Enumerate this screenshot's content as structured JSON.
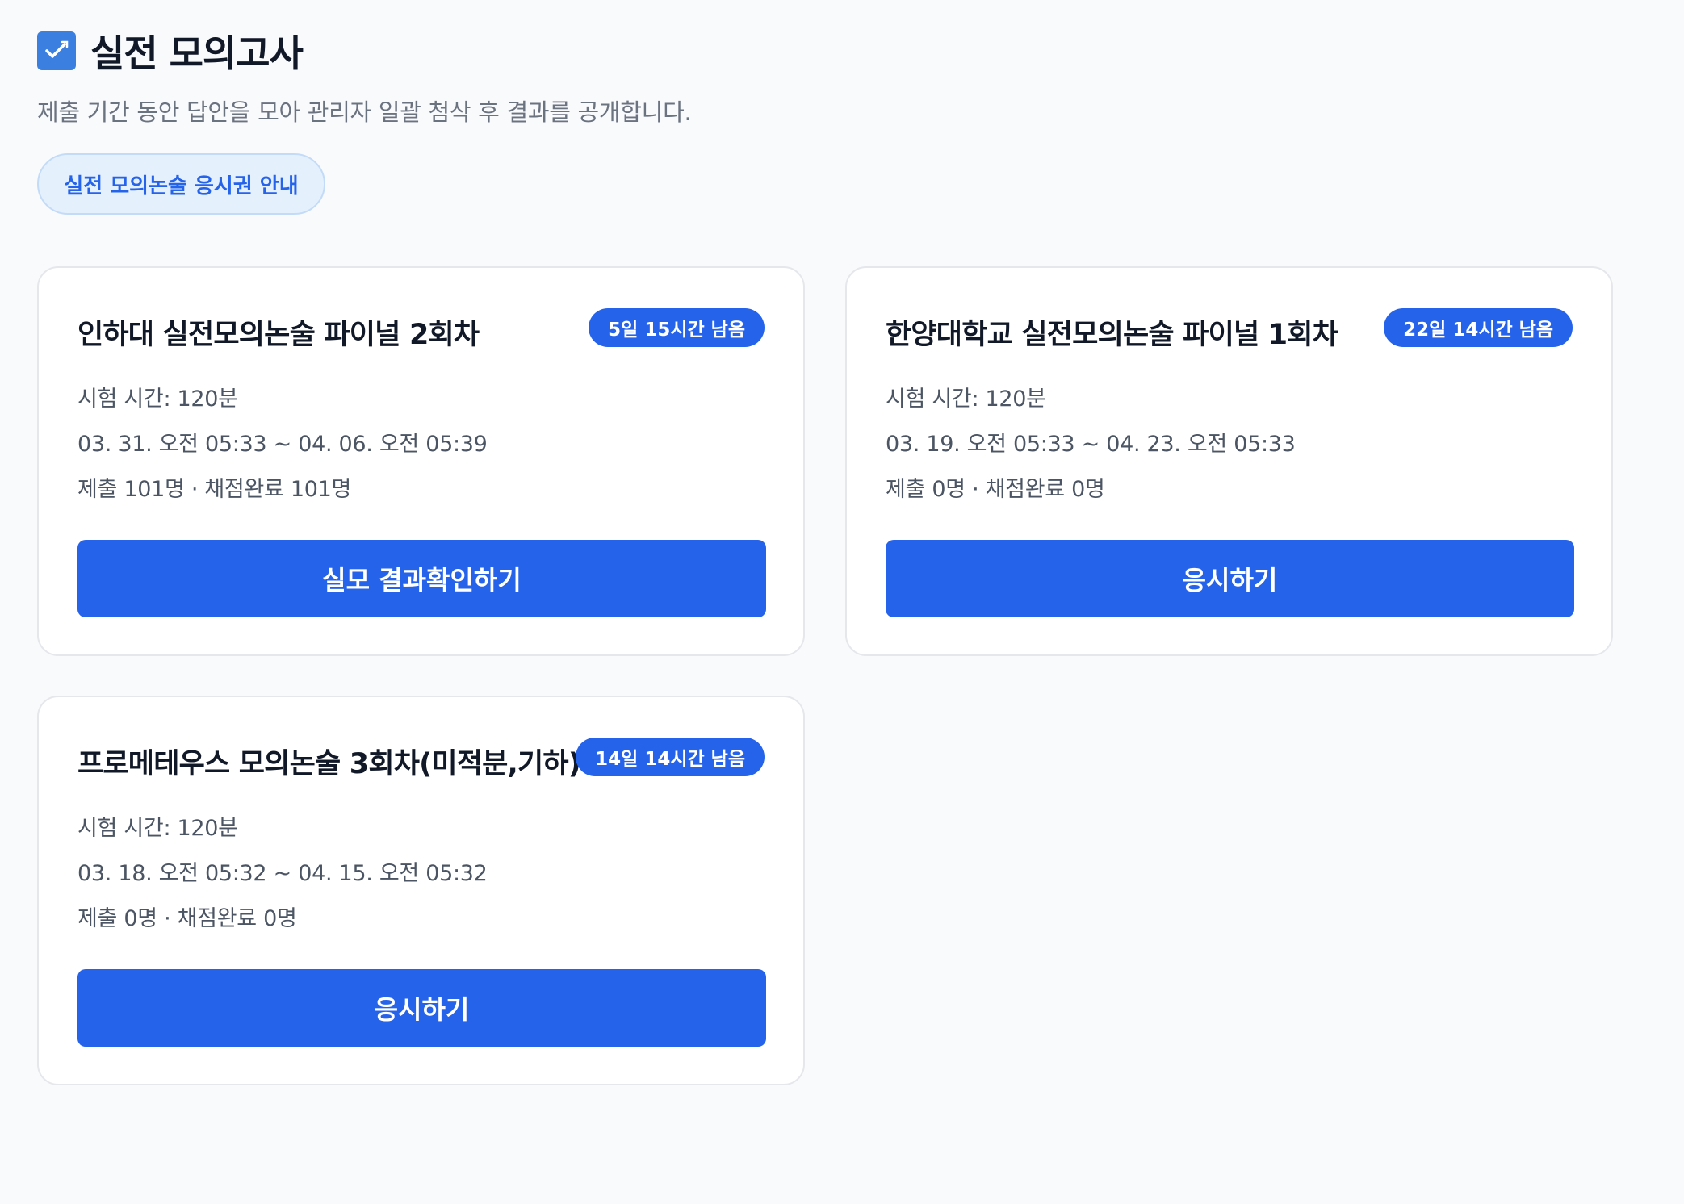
{
  "header": {
    "icon": "checkmark-pen-icon",
    "title": "실전 모의고사",
    "subtitle": "제출 기간 동안 답안을 모아 관리자 일괄 첨삭 후 결과를 공개합니다."
  },
  "info_button": {
    "label": "실전 모의논술 응시권 안내"
  },
  "colors": {
    "accent": "#2563eb",
    "pill_bg": "#e5f0fd",
    "page_bg": "#f8fafc"
  },
  "exams": [
    {
      "title": "인하대 실전모의논술 파이널 2회차",
      "badge": "5일 15시간 남음",
      "duration": "시험 시간: 120분",
      "period": "03. 31. 오전 05:33 ~ 04. 06. 오전 05:39",
      "stats": "제출 101명 · 채점완료 101명",
      "action": "실모 결과확인하기"
    },
    {
      "title": "한양대학교 실전모의논술 파이널 1회차",
      "badge": "22일 14시간 남음",
      "duration": "시험 시간: 120분",
      "period": "03. 19. 오전 05:33 ~ 04. 23. 오전 05:33",
      "stats": "제출 0명 · 채점완료 0명",
      "action": "응시하기"
    },
    {
      "title": "프로메테우스 모의논술 3회차(미적분,기하)",
      "badge": "14일 14시간 남음",
      "duration": "시험 시간: 120분",
      "period": "03. 18. 오전 05:32 ~ 04. 15. 오전 05:32",
      "stats": "제출 0명 · 채점완료 0명",
      "action": "응시하기"
    }
  ]
}
